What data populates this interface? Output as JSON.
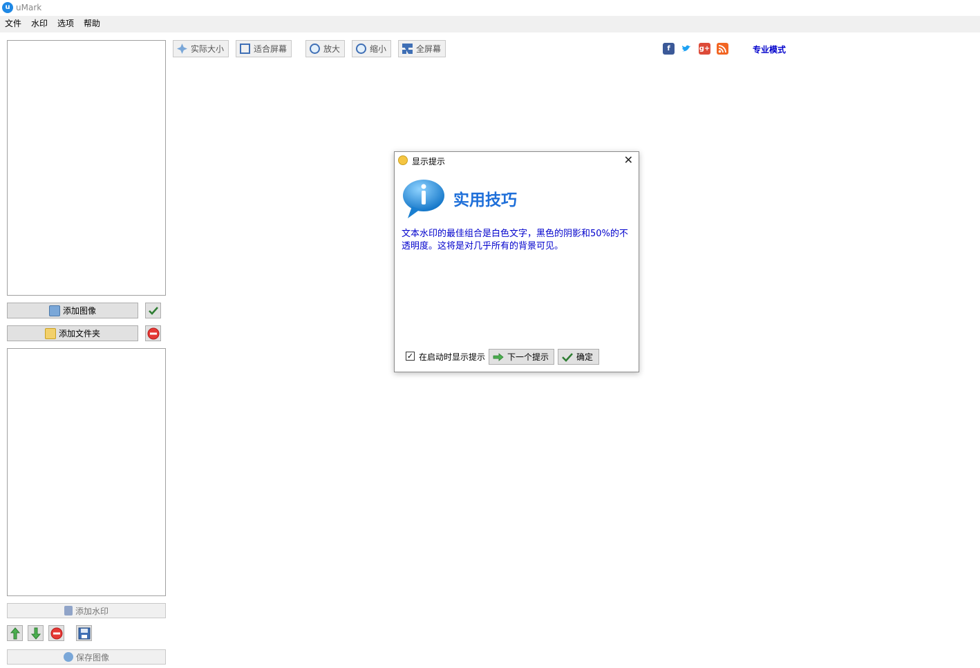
{
  "window": {
    "title": "uMark",
    "logo_letter": "u"
  },
  "menu": [
    "文件",
    "水印",
    "选项",
    "帮助"
  ],
  "toolbar": {
    "actual_size": "实际大小",
    "fit_screen": "适合屏幕",
    "zoom_in": "放大",
    "zoom_out": "缩小",
    "fullscreen": "全屏幕"
  },
  "social": {
    "facebook": "f",
    "google_plus": "g+"
  },
  "pro_mode_link": "专业模式",
  "left_panel": {
    "add_image": "添加图像",
    "add_folder": "添加文件夹",
    "add_watermark": "添加水印",
    "save_image": "保存图像"
  },
  "dialog": {
    "title": "显示提示",
    "heading": "实用技巧",
    "tip_text": "文本水印的最佳组合是白色文字，黑色的阴影和50%的不透明度。这将是对几乎所有的背景可见。",
    "show_on_startup": "在启动时显示提示",
    "show_on_startup_checked": true,
    "next_tip": "下一个提示",
    "ok": "确定"
  },
  "colors": {
    "accent": "#1e6fd9",
    "tip_text": "#0000cc",
    "link": "#0000cc"
  }
}
